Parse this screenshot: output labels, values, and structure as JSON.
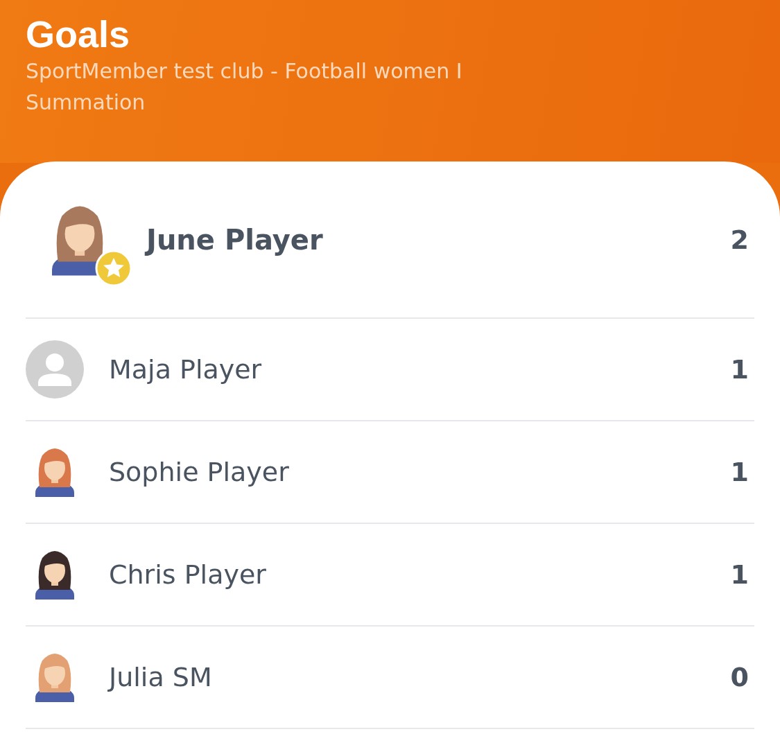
{
  "header": {
    "title": "Goals",
    "subtitle": "SportMember test club - Football women I",
    "caption": "Summation"
  },
  "players": [
    {
      "name": "June Player",
      "goals": "2",
      "leader": true,
      "kind": "figure",
      "color": "#a8795c"
    },
    {
      "name": "Maja Player",
      "goals": "1",
      "leader": false,
      "kind": "placeholder"
    },
    {
      "name": "Sophie Player",
      "goals": "1",
      "leader": false,
      "kind": "figure",
      "color": "#d9784a"
    },
    {
      "name": "Chris Player",
      "goals": "1",
      "leader": false,
      "kind": "figure",
      "color": "#3a2a2a"
    },
    {
      "name": "Julia SM",
      "goals": "0",
      "leader": false,
      "kind": "figure",
      "color": "#e3a072"
    }
  ]
}
